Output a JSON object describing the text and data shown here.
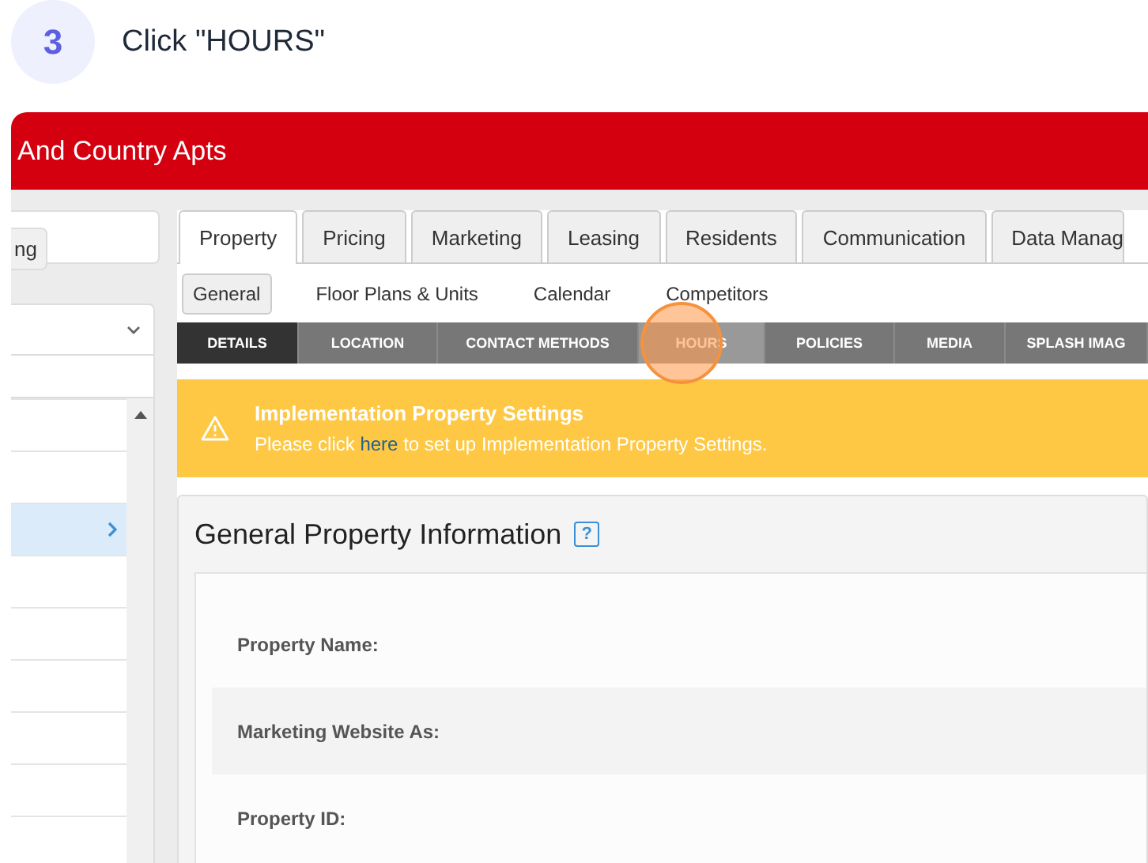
{
  "step": {
    "number": "3",
    "instruction": "Click \"HOURS\""
  },
  "app": {
    "title": "And Country Apts"
  },
  "sidebar": {
    "button": "ng",
    "rows": [
      {
        "selected": false
      },
      {
        "selected": false
      },
      {
        "selected": true
      },
      {
        "selected": false
      },
      {
        "selected": false
      },
      {
        "selected": false
      },
      {
        "selected": false
      },
      {
        "selected": false
      },
      {
        "selected": false
      }
    ]
  },
  "tabs": [
    {
      "label": "Property",
      "selected": true
    },
    {
      "label": "Pricing",
      "selected": false
    },
    {
      "label": "Marketing",
      "selected": false
    },
    {
      "label": "Leasing",
      "selected": false
    },
    {
      "label": "Residents",
      "selected": false
    },
    {
      "label": "Communication",
      "selected": false
    },
    {
      "label": "Data Manag",
      "selected": false
    }
  ],
  "subtabs": [
    {
      "label": "General",
      "selected": true
    },
    {
      "label": "Floor Plans & Units",
      "selected": false
    },
    {
      "label": "Calendar",
      "selected": false
    },
    {
      "label": "Competitors",
      "selected": false
    }
  ],
  "section_tabs": [
    {
      "label": "DETAILS",
      "selected": true,
      "highlighted": false
    },
    {
      "label": "LOCATION",
      "selected": false,
      "highlighted": false
    },
    {
      "label": "CONTACT METHODS",
      "selected": false,
      "highlighted": false
    },
    {
      "label": "HOURS",
      "selected": false,
      "highlighted": true
    },
    {
      "label": "POLICIES",
      "selected": false,
      "highlighted": false
    },
    {
      "label": "MEDIA",
      "selected": false,
      "highlighted": false
    },
    {
      "label": "SPLASH IMAG",
      "selected": false,
      "highlighted": false
    }
  ],
  "alert": {
    "title": "Implementation Property Settings",
    "text_before": "Please click",
    "link": "here",
    "text_after": "to set up Implementation Property Settings."
  },
  "panel": {
    "title": "General Property Information",
    "help": "?",
    "fields": [
      {
        "label": "Property Name:"
      },
      {
        "label": "Marketing Website As:"
      },
      {
        "label": "Property ID:"
      }
    ]
  }
}
